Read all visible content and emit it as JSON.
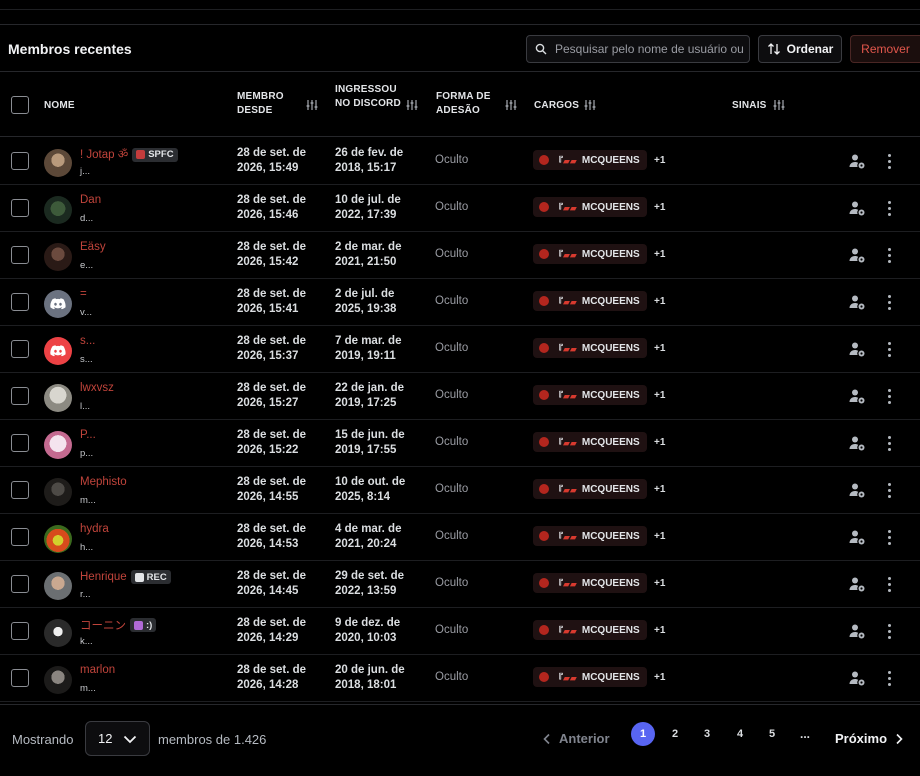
{
  "header": {
    "title": "Membros recentes",
    "search_placeholder": "Pesquisar pelo nome de usuário ou",
    "sort_label": "Ordenar",
    "remove_label": "Remover"
  },
  "columns": {
    "name": "NOME",
    "member_since": "MEMBRO DESDE",
    "joined_discord": "INGRESSOU NO DISCORD",
    "join_method": "FORMA DE ADESÃO",
    "roles": "CARGOS",
    "signals": "SINAIS"
  },
  "rows": [
    {
      "name": "! Jotap ॐ",
      "handle": "j...",
      "tag": "SPFC",
      "member_since_1": "28 de set. de",
      "member_since_2": "2026, 15:49",
      "joined_1": "26 de fev. de",
      "joined_2": "2018, 15:17",
      "join_method": "Oculto",
      "role": "MCQUEENS",
      "role_prefix": "『",
      "role_more": "+1"
    },
    {
      "name": "Dan",
      "handle": "d...",
      "tag": "",
      "member_since_1": "28 de set. de",
      "member_since_2": "2026, 15:46",
      "joined_1": "10 de jul. de",
      "joined_2": "2022, 17:39",
      "join_method": "Oculto",
      "role": "MCQUEENS",
      "role_prefix": "『",
      "role_more": "+1"
    },
    {
      "name": "Eäsy",
      "handle": "e...",
      "tag": "",
      "member_since_1": "28 de set. de",
      "member_since_2": "2026, 15:42",
      "joined_1": "2 de mar. de",
      "joined_2": "2021, 21:50",
      "join_method": "Oculto",
      "role": "MCQUEENS",
      "role_prefix": "『",
      "role_more": "+1"
    },
    {
      "name": "=",
      "handle": "v...",
      "tag": "",
      "member_since_1": "28 de set. de",
      "member_since_2": "2026, 15:41",
      "joined_1": "2 de jul. de",
      "joined_2": "2025, 19:38",
      "join_method": "Oculto",
      "role": "MCQUEENS",
      "role_prefix": "『",
      "role_more": "+1"
    },
    {
      "name": "s...",
      "handle": "s...",
      "tag": "",
      "member_since_1": "28 de set. de",
      "member_since_2": "2026, 15:37",
      "joined_1": "7 de mar. de",
      "joined_2": "2019, 19:11",
      "join_method": "Oculto",
      "role": "MCQUEENS",
      "role_prefix": "『",
      "role_more": "+1"
    },
    {
      "name": "lwxvsz",
      "handle": "l...",
      "tag": "",
      "member_since_1": "28 de set. de",
      "member_since_2": "2026, 15:27",
      "joined_1": "22 de jan. de",
      "joined_2": "2019, 17:25",
      "join_method": "Oculto",
      "role": "MCQUEENS",
      "role_prefix": "『",
      "role_more": "+1"
    },
    {
      "name": "P...",
      "handle": "p...",
      "tag": "",
      "member_since_1": "28 de set. de",
      "member_since_2": "2026, 15:22",
      "joined_1": "15 de jun. de",
      "joined_2": "2019, 17:55",
      "join_method": "Oculto",
      "role": "MCQUEENS",
      "role_prefix": "『",
      "role_more": "+1"
    },
    {
      "name": "Mephisto",
      "handle": "m...",
      "tag": "",
      "member_since_1": "28 de set. de",
      "member_since_2": "2026, 14:55",
      "joined_1": "10 de out. de",
      "joined_2": "2025, 8:14",
      "join_method": "Oculto",
      "role": "MCQUEENS",
      "role_prefix": "『",
      "role_more": "+1"
    },
    {
      "name": "hydra",
      "handle": "h...",
      "tag": "",
      "member_since_1": "28 de set. de",
      "member_since_2": "2026, 14:53",
      "joined_1": "4 de mar. de",
      "joined_2": "2021, 20:24",
      "join_method": "Oculto",
      "role": "MCQUEENS",
      "role_prefix": "『",
      "role_more": "+1"
    },
    {
      "name": "Henrique",
      "handle": "r...",
      "tag": "REC",
      "member_since_1": "28 de set. de",
      "member_since_2": "2026, 14:45",
      "joined_1": "29 de set. de",
      "joined_2": "2022, 13:59",
      "join_method": "Oculto",
      "role": "MCQUEENS",
      "role_prefix": "『",
      "role_more": "+1"
    },
    {
      "name": "コーニン",
      "handle": "k...",
      "tag": ":)",
      "member_since_1": "28 de set. de",
      "member_since_2": "2026, 14:29",
      "joined_1": "9 de dez. de",
      "joined_2": "2020, 10:03",
      "join_method": "Oculto",
      "role": "MCQUEENS",
      "role_prefix": "『",
      "role_more": "+1"
    },
    {
      "name": "marlon",
      "handle": "m...",
      "tag": "",
      "member_since_1": "28 de set. de",
      "member_since_2": "2026, 14:28",
      "joined_1": "20 de jun. de",
      "joined_2": "2018, 18:01",
      "join_method": "Oculto",
      "role": "MCQUEENS",
      "role_prefix": "『",
      "role_more": "+1"
    }
  ],
  "footer": {
    "showing_label": "Mostrando",
    "page_size": "12",
    "total_label": "membros de 1.426",
    "prev_label": "Anterior",
    "pages": [
      "1",
      "2",
      "3",
      "4",
      "5"
    ],
    "ellipsis": "...",
    "next_label": "Próximo"
  },
  "colors": {
    "accent": "#5865f2",
    "username": "#c0443b",
    "danger": "#e2574c",
    "role_dot": "#b3261e"
  }
}
